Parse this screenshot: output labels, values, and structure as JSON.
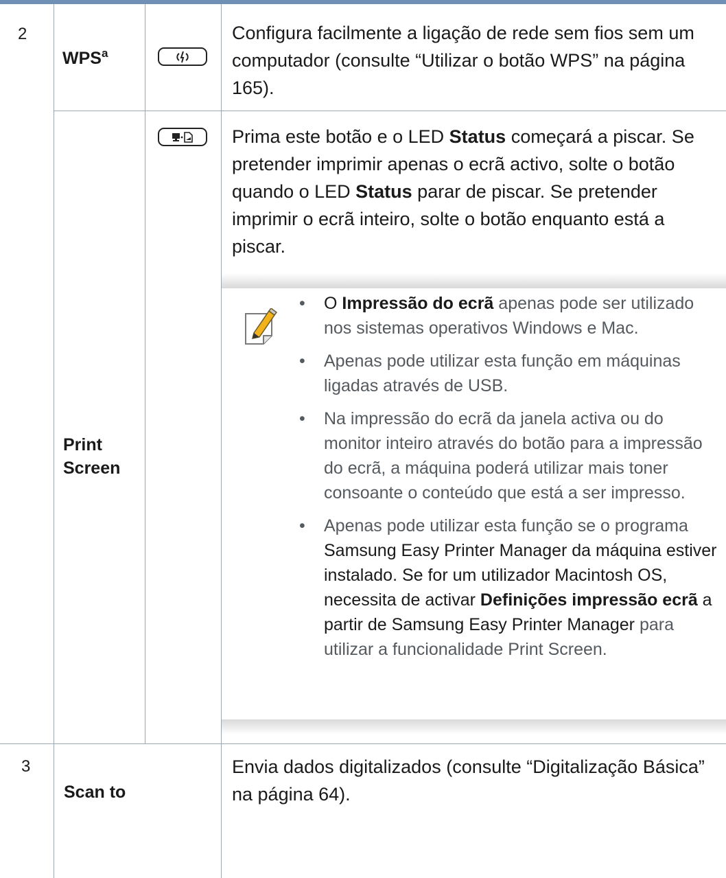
{
  "rows": [
    {
      "number": "2",
      "label_main": "WPS",
      "label_sup": "a",
      "desc": "Configura facilmente a ligação de rede sem fios sem um computador (consulte “Utilizar o botão WPS” na página 165)."
    },
    {
      "label_line1": "Print",
      "label_line2": "Screen",
      "desc_p1": "Prima este botão e o LED ",
      "desc_b1": "Status",
      "desc_p2": " começará a piscar. Se pretender imprimir apenas o ecrã activo, solte o botão quando o LED ",
      "desc_b2": "Status",
      "desc_p3": " parar de piscar. Se pretender imprimir o ecrã inteiro, solte o botão enquanto está a piscar.",
      "notes": {
        "b1_pre": "O ",
        "b1_bold": "Impressão do ecrã",
        "b1_post": " apenas pode ser utilizado nos sistemas operativos Windows e Mac.",
        "b2": "Apenas pode utilizar esta função em máquinas ligadas através de USB.",
        "b3": "Na impressão do ecrã da janela activa ou do monitor inteiro através do botão para a impressão do ecrã, a máquina poderá utilizar mais toner consoante o conteúdo que está a ser impresso.",
        "b4_a": "Apenas pode utilizar esta função se o programa ",
        "b4_b": "Samsung Easy Printer Manager da máquina estiver instalado. Se for um utilizador Macintosh OS, necessita de activar ",
        "b4_bold": "Definições impressão ecrã",
        "b4_c": " a partir de Samsung Easy Printer Manager",
        "b4_d": " para utilizar a funcionalidade Print Screen."
      }
    },
    {
      "number": "3",
      "label": "Scan to",
      "desc": "Envia dados digitalizados (consulte “Digitalização Básica” na página 64)."
    }
  ],
  "icons": {
    "wps_button": "wps-button-icon",
    "print_screen_button": "print-screen-button-icon",
    "note": "note-pencil-icon"
  },
  "colors": {
    "top_bar": "#6f8fb4",
    "grid": "#9aa6b2",
    "note_text": "#555a5f"
  }
}
